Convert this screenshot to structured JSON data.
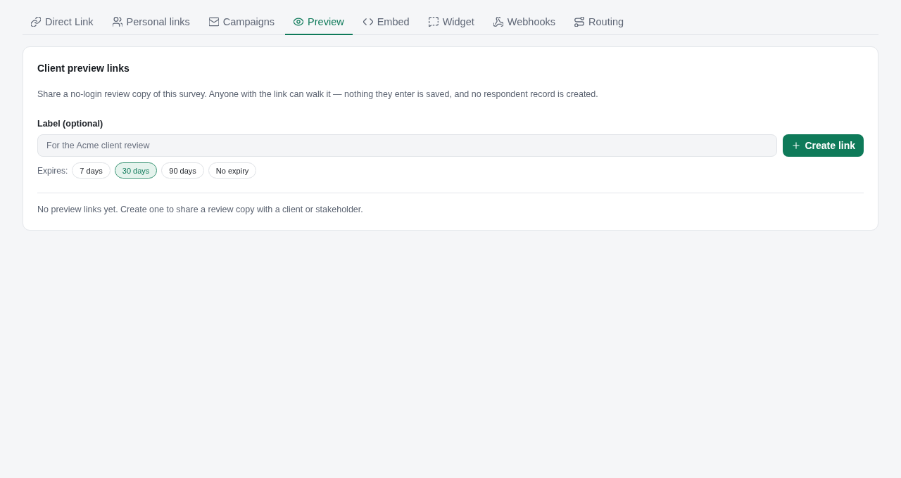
{
  "tabs": [
    {
      "label": "Direct Link",
      "selected": false
    },
    {
      "label": "Personal links",
      "selected": false
    },
    {
      "label": "Campaigns",
      "selected": false
    },
    {
      "label": "Preview",
      "selected": true
    },
    {
      "label": "Embed",
      "selected": false
    },
    {
      "label": "Widget",
      "selected": false
    },
    {
      "label": "Webhooks",
      "selected": false
    },
    {
      "label": "Routing",
      "selected": false
    }
  ],
  "card": {
    "title": "Client preview links",
    "description": "Share a no-login review copy of this survey. Anyone with the link can walk it — nothing they enter is saved, and no respondent record is created.",
    "label_field": {
      "label": "Label (optional)",
      "placeholder": "For the Acme client review"
    },
    "create_button": {
      "label": "Create link"
    },
    "expiry": {
      "label": "Expires:",
      "options": [
        {
          "label": "7 days",
          "selected": false
        },
        {
          "label": "30 days",
          "selected": true
        },
        {
          "label": "90 days",
          "selected": false
        },
        {
          "label": "No expiry",
          "selected": false
        }
      ]
    },
    "empty_message": "No preview links yet. Create one to share a review copy with a client or stakeholder."
  }
}
